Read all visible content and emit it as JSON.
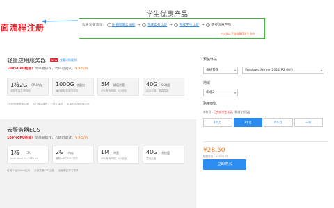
{
  "page_title": "学生优惠产品",
  "annotation": {
    "label": "面流程注册",
    "arrow_color": "#2d8cf0",
    "box_color": "#3dbb3d",
    "label_color": "#e5232b"
  },
  "flow": {
    "lead": "优惠享受流程：",
    "steps": [
      {
        "num": "1",
        "label": "注册阿里云账号"
      },
      {
        "num": "2",
        "label": "完成实名认证"
      },
      {
        "num": "3",
        "label": "完成学生认证"
      },
      {
        "num": "4",
        "label": "购买优惠产品"
      }
    ],
    "arrow": "→",
    "note": "*24岁以下自动获得学生身份"
  },
  "light_server": {
    "title": "轻量应用服务器",
    "badge": "NEW",
    "link": "查看详情规则",
    "subtitle_highlight": "100%CPU性能！",
    "subtitle_text": "简单易操作，代码可调试。",
    "subtitle_price": "¥ 9.5/月",
    "specs": [
      {
        "big": "1核2G",
        "unit": "CPU内存",
        "desc": "全部享用共享网络"
      },
      {
        "big": "1000G",
        "unit": "流量包",
        "desc": "每月全部高速流量包"
      },
      {
        "big": "5M",
        "unit": "峰值带宽",
        "desc": "VPC专有网络，I/O优化"
      },
      {
        "big": "40G",
        "unit": "SSD盘",
        "desc": "SSD云盘，更高性能"
      }
    ],
    "footer": [
      "1分钟快速搭建应用",
      "入门建站推荐，一站式体验",
      "丰富的应用镜像可选"
    ]
  },
  "ecs": {
    "title": "云服务器ECS",
    "subtitle_highlight": "100%CPU性能！",
    "subtitle_text": "简单易操作，代码可调试。",
    "subtitle_price": "¥ 9.5/月",
    "specs": [
      {
        "big": "1核",
        "unit": "CPU",
        "desc": "Intel Xeon E5-2682 v4"
      },
      {
        "big": "2G",
        "unit": "内存",
        "desc": "最新一代DDR4内存"
      },
      {
        "big": "1M",
        "unit": "带宽",
        "desc": "VPC专有网络，I/O优化"
      },
      {
        "big": "40G",
        "unit": "系统盘",
        "desc": "高效云盘"
      }
    ],
    "footer": [
      "可用于运行Web应用",
      "全部高速SSD云盘",
      "全面覆盖学习场景"
    ]
  },
  "right_panel": {
    "env_label": "预装环境",
    "env_option": "系统镜像",
    "os_option": "Windows Server 2012 R2 64位",
    "region_label": "地域",
    "region_option": "华北2",
    "duration_label": "购买时长",
    "duration_note_prefix": "单账号，",
    "duration_note_red": "已完成学生认证",
    "duration_note_suffix": "，解绑全部权益",
    "durations": [
      "1个月",
      "3个月",
      "6个月",
      "一年"
    ],
    "selected_duration": "3个月",
    "price": "¥28.50",
    "price_sub": "配置费用：¥28.50/月",
    "buy_label": "立即购买",
    "accent_color": "#2d8cf0",
    "price_color": "#f5781e"
  }
}
